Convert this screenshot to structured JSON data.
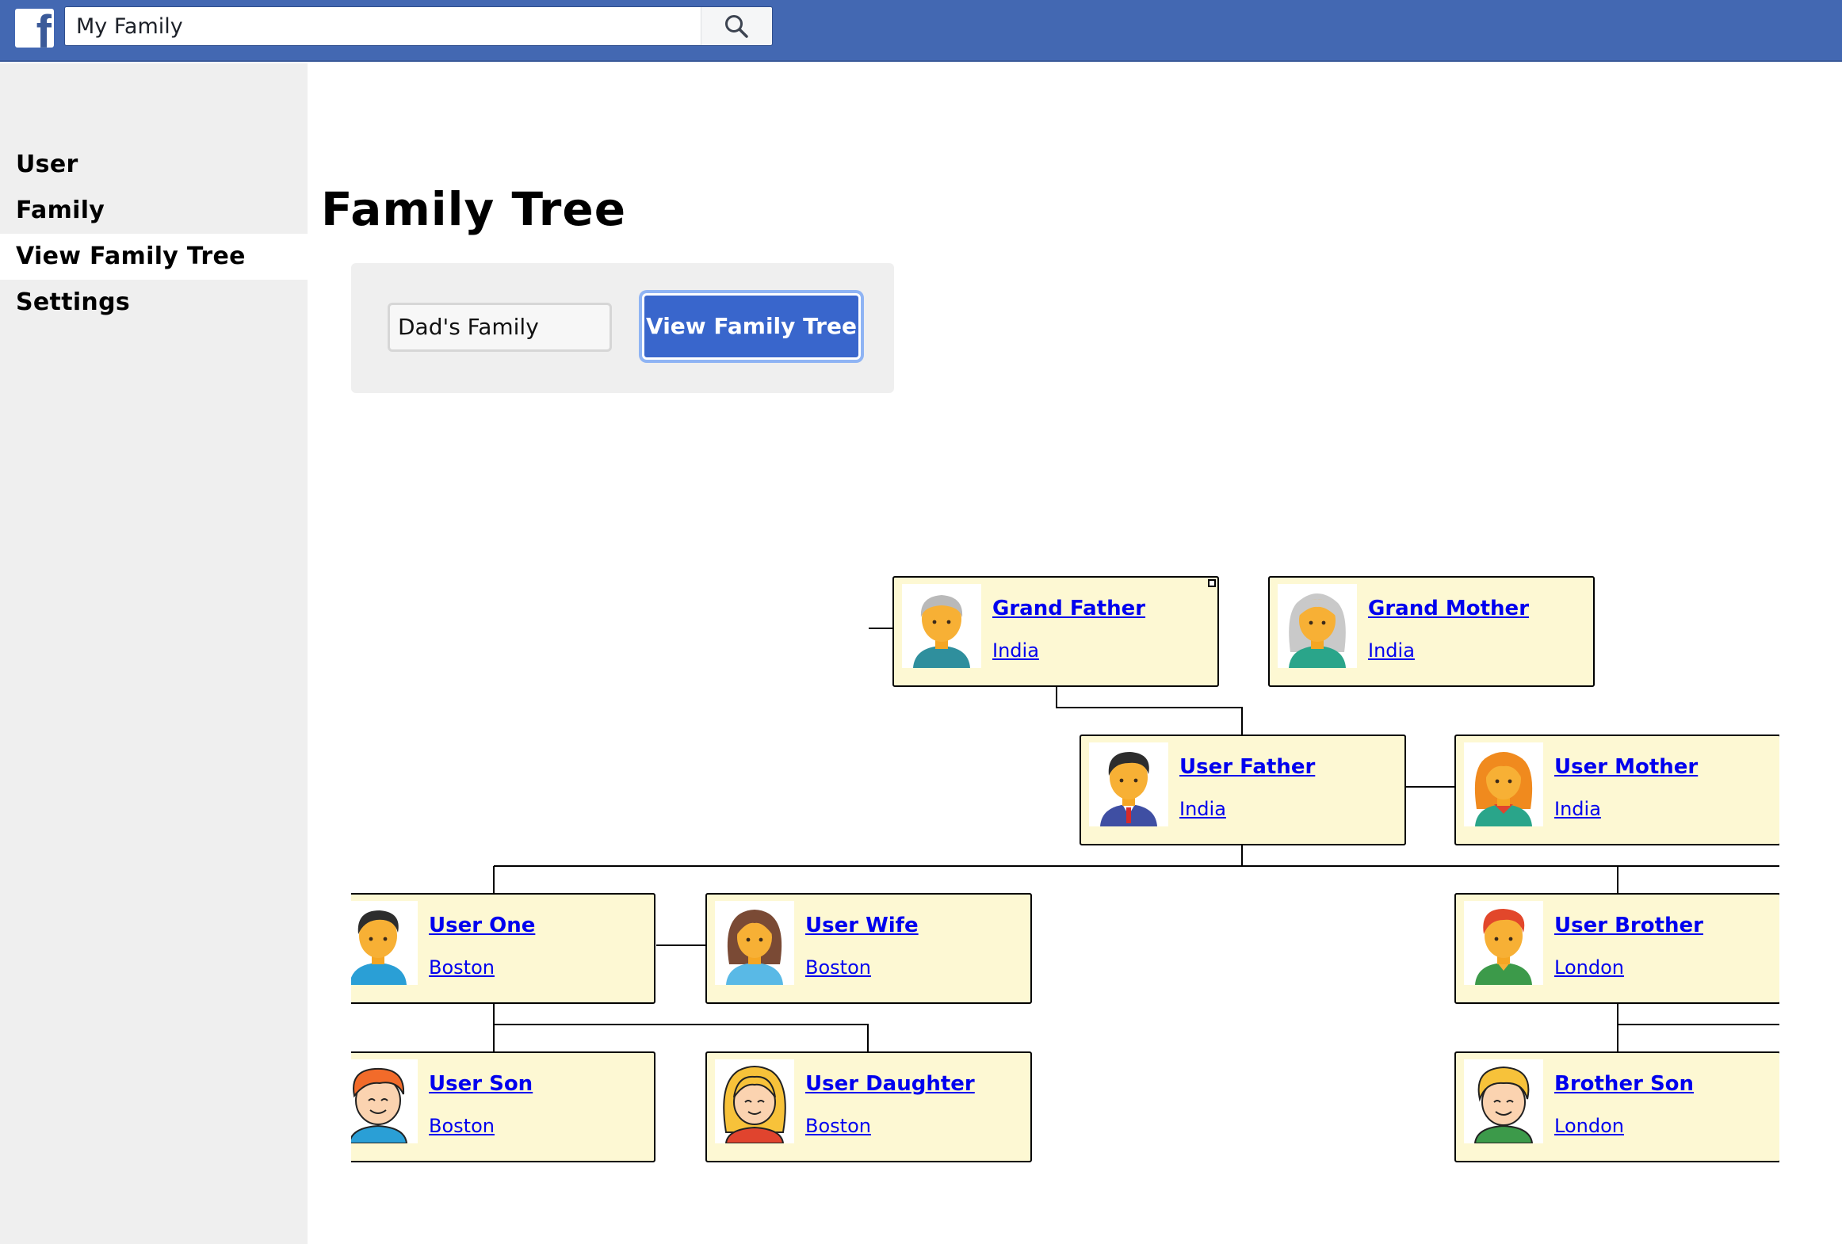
{
  "header": {
    "search_value": "My Family",
    "brand_color": "#4368b2"
  },
  "sidebar": {
    "items": [
      {
        "label": "User",
        "active": false
      },
      {
        "label": "Family",
        "active": false
      },
      {
        "label": "View Family Tree",
        "active": true
      },
      {
        "label": "Settings",
        "active": false
      }
    ]
  },
  "main": {
    "title": "Family Tree",
    "family_select_value": "Dad's Family",
    "view_button_label": "View Family Tree",
    "button_color": "#3966cc"
  },
  "tree": {
    "card_color": "#fdf8d3",
    "members": [
      {
        "name": "Grand Father",
        "place": "India",
        "icon": "grandfather-avatar-icon"
      },
      {
        "name": "Grand Mother",
        "place": "India",
        "icon": "grandmother-avatar-icon"
      },
      {
        "name": "User Father",
        "place": "India",
        "icon": "father-avatar-icon"
      },
      {
        "name": "User Mother",
        "place": "India",
        "icon": "mother-avatar-icon"
      },
      {
        "name": "User One",
        "place": "Boston",
        "icon": "man-avatar-icon"
      },
      {
        "name": "User Wife",
        "place": "Boston",
        "icon": "woman-avatar-icon"
      },
      {
        "name": "User Brother",
        "place": "London",
        "icon": "brother-avatar-icon"
      },
      {
        "name": "User Son",
        "place": "Boston",
        "icon": "boy-avatar-icon"
      },
      {
        "name": "User Daughter",
        "place": "Boston",
        "icon": "girl-avatar-icon"
      },
      {
        "name": "Brother Son",
        "place": "London",
        "icon": "nephew-avatar-icon"
      }
    ]
  }
}
